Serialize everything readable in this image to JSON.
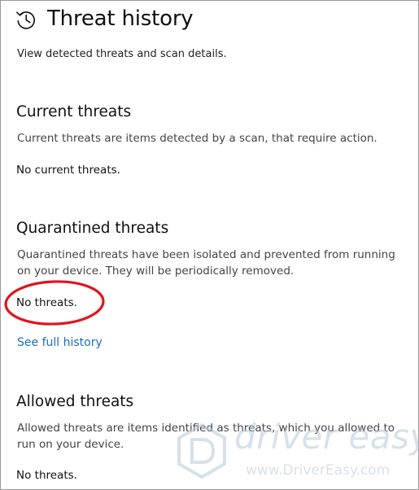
{
  "header": {
    "icon": "history-clock-icon",
    "title": "Threat history",
    "subtitle": "View detected threats and scan details."
  },
  "sections": {
    "current": {
      "title": "Current threats",
      "description": "Current threats are items detected by a scan, that require action.",
      "status": "No current threats."
    },
    "quarantined": {
      "title": "Quarantined threats",
      "description": "Quarantined threats have been isolated and prevented from running on your device.  They will be periodically removed.",
      "status": "No threats.",
      "link": "See full history"
    },
    "allowed": {
      "title": "Allowed threats",
      "description": "Allowed threats are items identified as threats, which you allowed to run on your device.",
      "status": "No threats."
    }
  },
  "annotation": {
    "color": "#e0141e"
  },
  "watermark": {
    "brand": "driver easy",
    "url": "www.DriverEasy.com",
    "color": "#b9c7d8"
  },
  "colors": {
    "link": "#1a6fb5",
    "text": "#111111",
    "muted": "#444444"
  }
}
